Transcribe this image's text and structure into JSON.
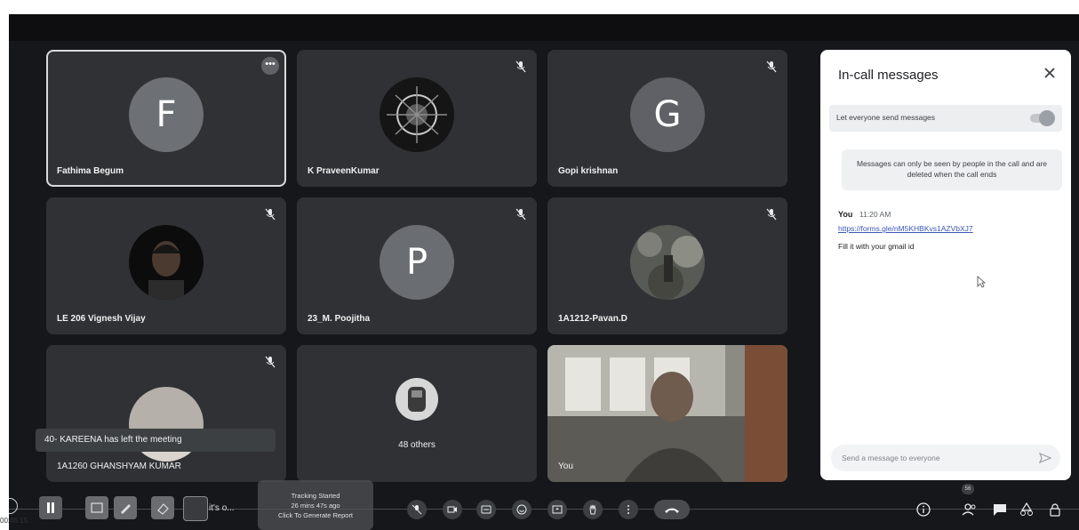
{
  "panel": {
    "title": "In-call messages",
    "toggle_label": "Let everyone send messages",
    "notice": "Messages can only be seen by people in the call and are deleted when the call ends",
    "message": {
      "sender": "You",
      "time": "11:20 AM",
      "link": "https://forms.gle/nM5KHBKvs1AZVbXJ7",
      "text": "Fill it with your gmail id"
    },
    "input_placeholder": "Send a message to everyone"
  },
  "tiles": [
    {
      "name": "Fathima Begum",
      "letter": "F"
    },
    {
      "name": "K PraveenKumar"
    },
    {
      "name": "Gopi krishnan",
      "letter": "G"
    },
    {
      "name": "LE 206 Vignesh Vijay"
    },
    {
      "name": "23_M. Poojitha",
      "letter": "P"
    },
    {
      "name": "1A1212-Pavan.D"
    },
    {
      "name": "1A1260 GHANSHYAM KUMAR"
    },
    {
      "name": "48 others"
    },
    {
      "name": "You"
    }
  ],
  "toast": "40- KAREENA has left the meeting",
  "recorder": {
    "line1": "Tracking Started",
    "line2": "26 mins 47s ago",
    "line3": "Click To Generate Report"
  },
  "caption": "it's o...",
  "participants_badge": "56",
  "clock": "00:46:15",
  "colors": {
    "avatar_f": "#6d7176",
    "avatar_g": "#5f6166",
    "avatar_p": "#6a6d72"
  }
}
